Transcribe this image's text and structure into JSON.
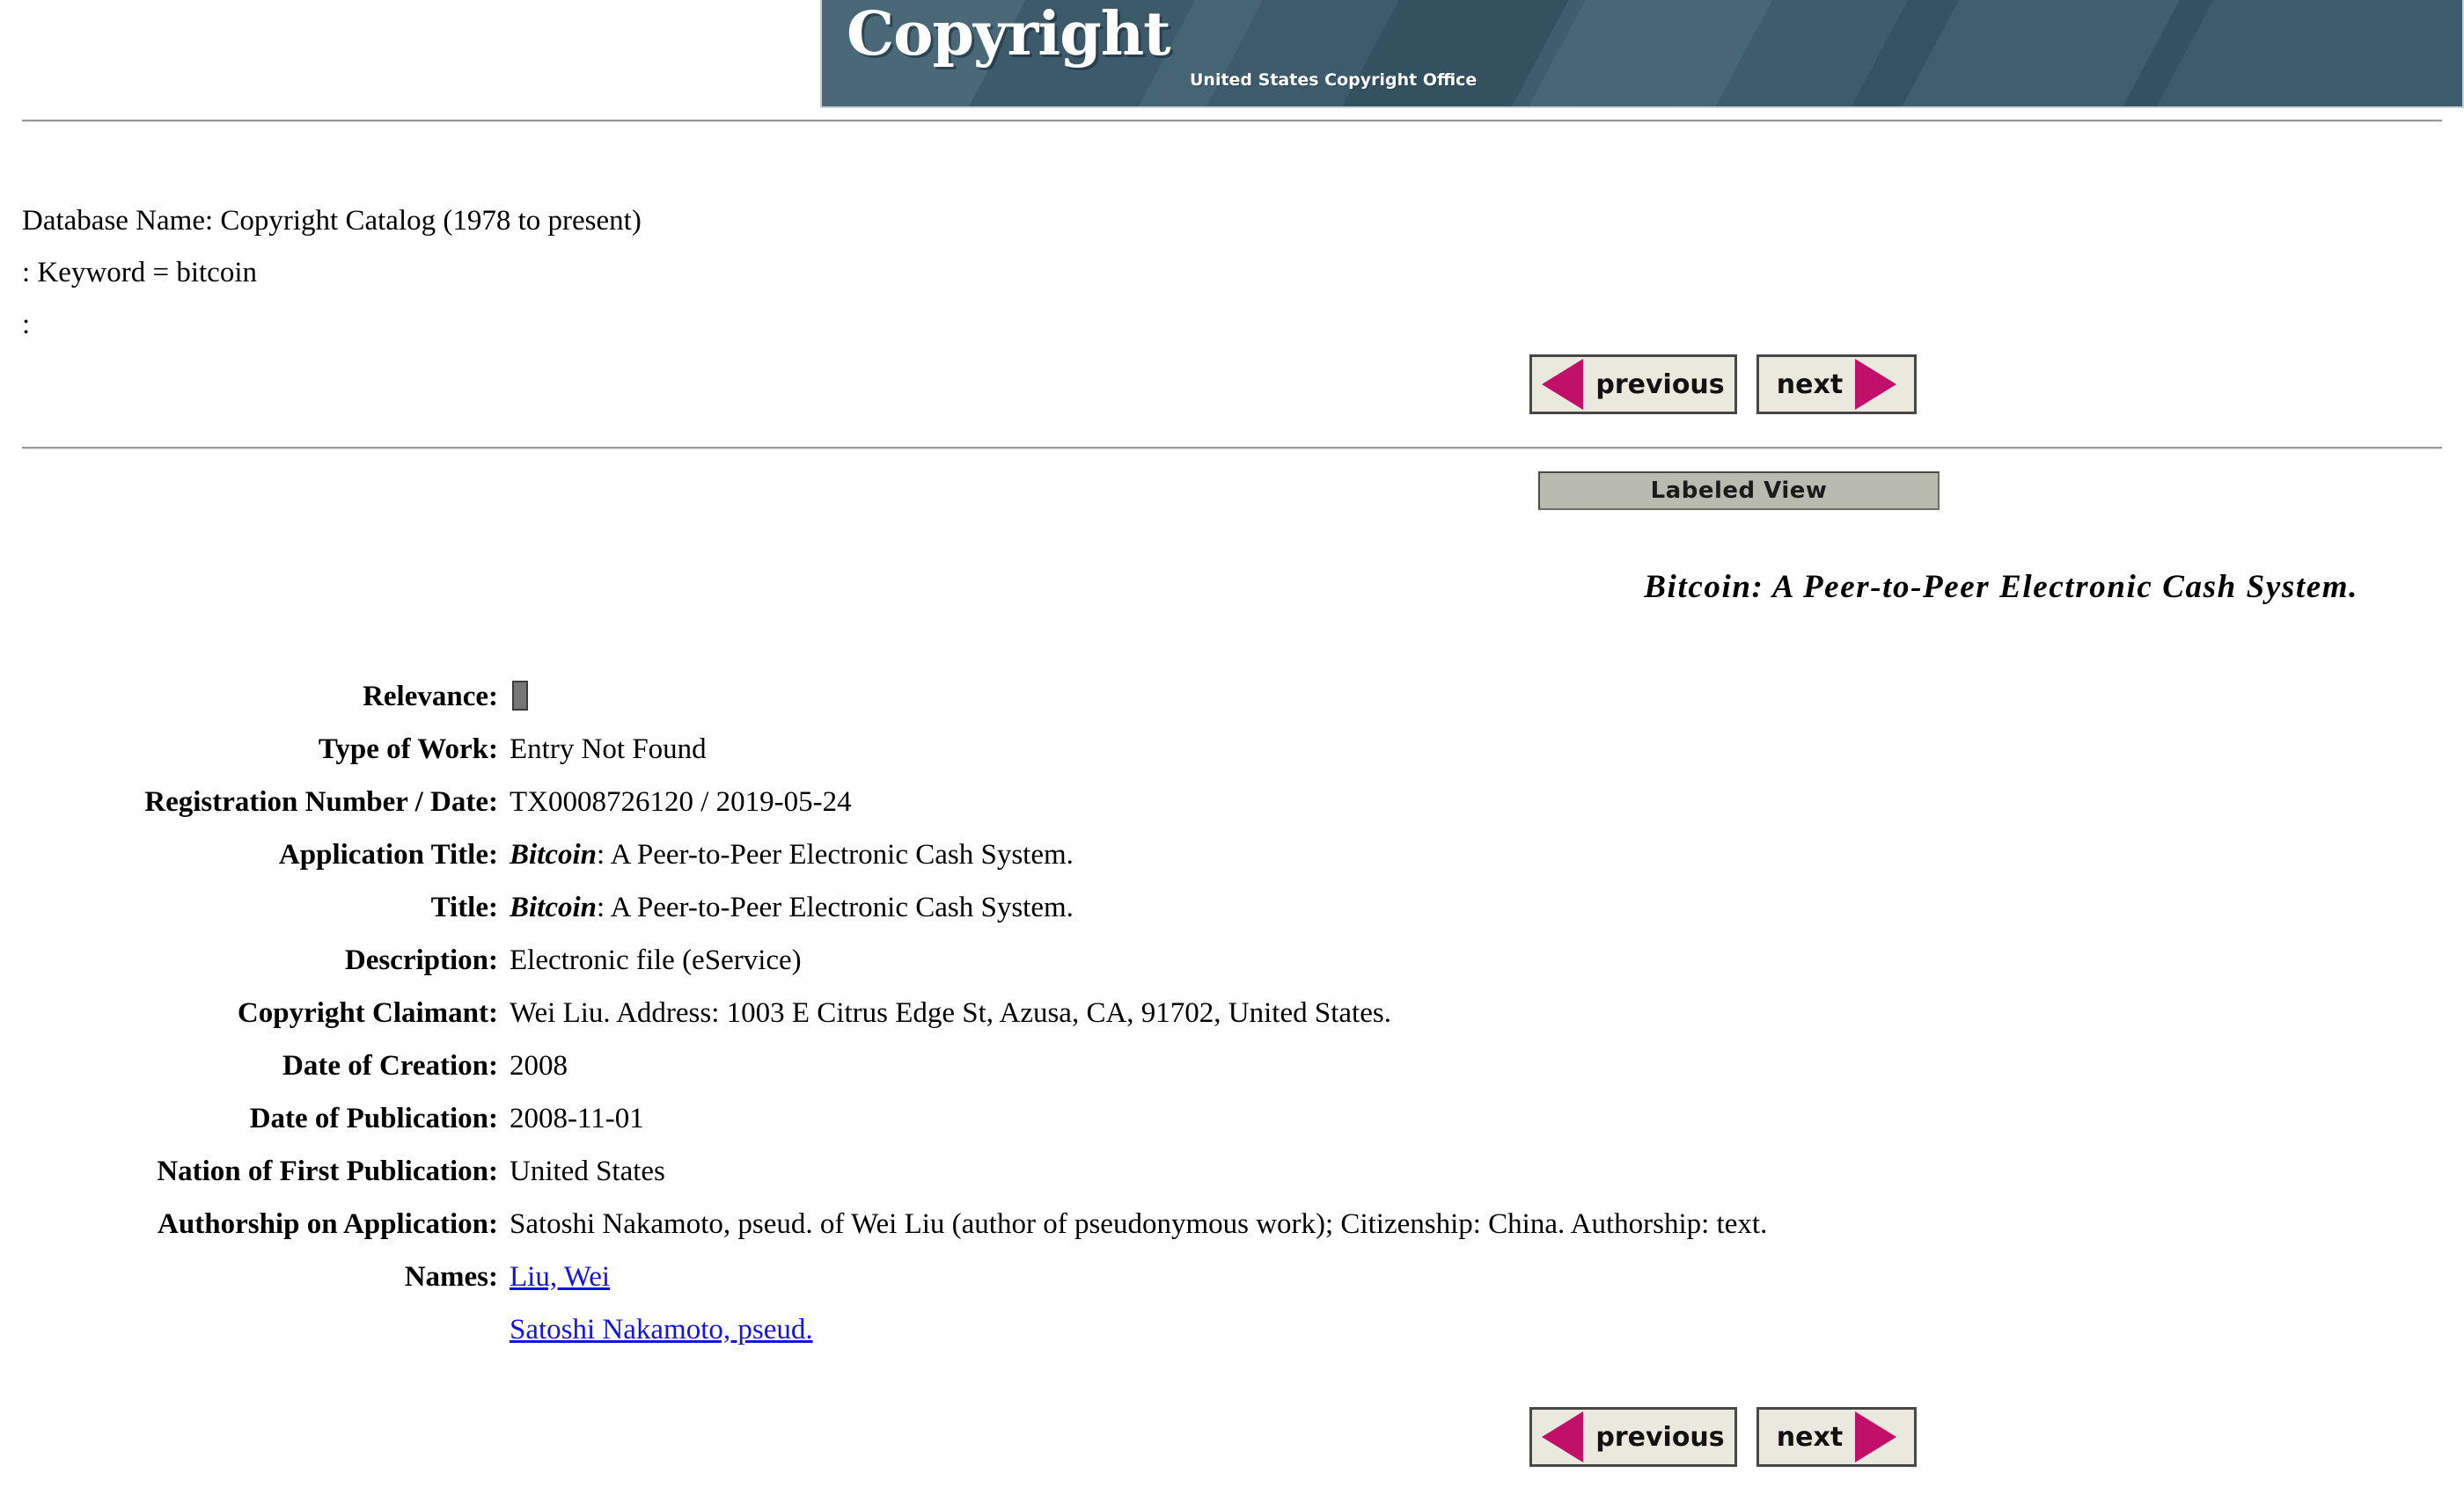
{
  "banner": {
    "title": "Copyright",
    "subtitle": "United States Copyright Office",
    "logo_icon": "copyright-c-icon",
    "background_color": "#395a6b"
  },
  "query": {
    "line1": "Database Name: Copyright Catalog (1978 to present)",
    "line2": ": Keyword = bitcoin",
    "line3": ":"
  },
  "nav": {
    "previous_label": "previous",
    "next_label": "next",
    "arrow_color": "#c2106a",
    "button_background": "#e9e9dd"
  },
  "view_toggle": {
    "label": "Labeled View",
    "background": "#b9bbb0"
  },
  "record": {
    "title": "Bitcoin: A Peer-to-Peer Electronic Cash System.",
    "fields": [
      {
        "label": "Relevance:",
        "value": ""
      },
      {
        "label": "Type of Work:",
        "value": "Entry Not Found"
      },
      {
        "label": "Registration Number / Date:",
        "value": "TX0008726120 / 2019-05-24"
      },
      {
        "label": "Application Title:",
        "value_emphasis": "Bitcoin",
        "value": ": A Peer-to-Peer Electronic Cash System."
      },
      {
        "label": "Title:",
        "value_emphasis": "Bitcoin",
        "value": ": A Peer-to-Peer Electronic Cash System."
      },
      {
        "label": "Description:",
        "value": "Electronic file (eService)"
      },
      {
        "label": "Copyright Claimant:",
        "value": "Wei Liu. Address: 1003 E Citrus Edge St, Azusa, CA, 91702, United States."
      },
      {
        "label": "Date of Creation:",
        "value": "2008"
      },
      {
        "label": "Date of Publication:",
        "value": "2008-11-01"
      },
      {
        "label": "Nation of First Publication:",
        "value": "United States"
      },
      {
        "label": "Authorship on Application:",
        "value": "Satoshi Nakamoto, pseud. of Wei Liu (author of pseudonymous work); Citizenship: China. Authorship: text."
      },
      {
        "label": "Names:",
        "value": ""
      }
    ],
    "names_label": "Names:",
    "names": [
      "Liu, Wei",
      "Satoshi Nakamoto, pseud."
    ],
    "link_color": "#1414e0"
  }
}
